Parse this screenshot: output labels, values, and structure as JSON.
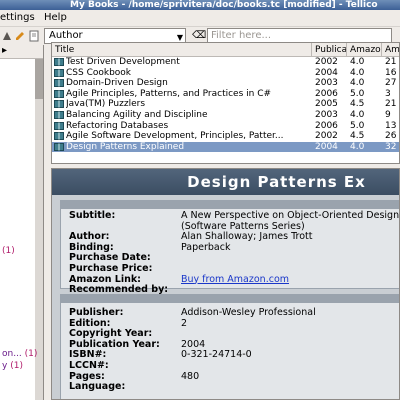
{
  "window": {
    "title": "My Books - /home/sprivitera/doc/books.tc [modified] - Tellico"
  },
  "menubar": {
    "items": [
      {
        "label": "ettings"
      },
      {
        "label": "Help"
      }
    ]
  },
  "toolbar": {
    "group_by_value": "Author",
    "filter_placeholder": "Filter here..."
  },
  "left_pane": {
    "items": [
      {
        "label": "",
        "count": "(1)"
      },
      {
        "label": "on...",
        "count": "(1)"
      },
      {
        "label": "y",
        "count": "(1)"
      }
    ]
  },
  "table": {
    "columns": [
      {
        "label": "Title"
      },
      {
        "label": "Publica"
      },
      {
        "label": "Amazo"
      },
      {
        "label": "Am"
      }
    ],
    "rows": [
      {
        "title": "Test Driven Development",
        "year": "2002",
        "rating": "4.0",
        "amz": "21"
      },
      {
        "title": "CSS Cookbook",
        "year": "2004",
        "rating": "4.0",
        "amz": "16"
      },
      {
        "title": "Domain-Driven Design",
        "year": "2003",
        "rating": "4.0",
        "amz": "27"
      },
      {
        "title": "Agile Principles, Patterns, and Practices in C#",
        "year": "2006",
        "rating": "5.0",
        "amz": "3"
      },
      {
        "title": "Java(TM) Puzzlers",
        "year": "2005",
        "rating": "4.5",
        "amz": "21"
      },
      {
        "title": "Balancing Agility and Discipline",
        "year": "2003",
        "rating": "4.0",
        "amz": "9"
      },
      {
        "title": "Refactoring Databases",
        "year": "2006",
        "rating": "5.0",
        "amz": "13"
      },
      {
        "title": "Agile Software Development, Principles, Patter...",
        "year": "2002",
        "rating": "4.5",
        "amz": "26"
      },
      {
        "title": "Design Patterns Explained",
        "year": "2004",
        "rating": "4.0",
        "amz": "32",
        "selected": true
      }
    ]
  },
  "details": {
    "banner_title": "Design Patterns Ex",
    "section1": [
      {
        "label": "Subtitle:",
        "value": "A New Perspective on Object-Oriented Design"
      },
      {
        "label": "",
        "value": "(Software Patterns Series)"
      },
      {
        "label": "Author:",
        "value": "Alan Shalloway; James Trott"
      },
      {
        "label": "Binding:",
        "value": "Paperback"
      },
      {
        "label": "Purchase Date:",
        "value": ""
      },
      {
        "label": "Purchase Price:",
        "value": ""
      },
      {
        "label": "Amazon Link:",
        "value": "Buy from Amazon.com",
        "link": true
      },
      {
        "label": "Recommended by:",
        "value": ""
      }
    ],
    "section2": [
      {
        "label": "Publisher:",
        "value": "Addison-Wesley Professional"
      },
      {
        "label": "Edition:",
        "value": "2"
      },
      {
        "label": "Copyright Year:",
        "value": ""
      },
      {
        "label": "Publication Year:",
        "value": "2004"
      },
      {
        "label": "ISBN#:",
        "value": "0-321-24714-0"
      },
      {
        "label": "LCCN#:",
        "value": ""
      },
      {
        "label": "Pages:",
        "value": "480"
      },
      {
        "label": "Language:",
        "value": ""
      }
    ]
  },
  "colors": {
    "selection": "#7c99c4",
    "banner": "#3b4d62",
    "link": "#1a37c9"
  }
}
